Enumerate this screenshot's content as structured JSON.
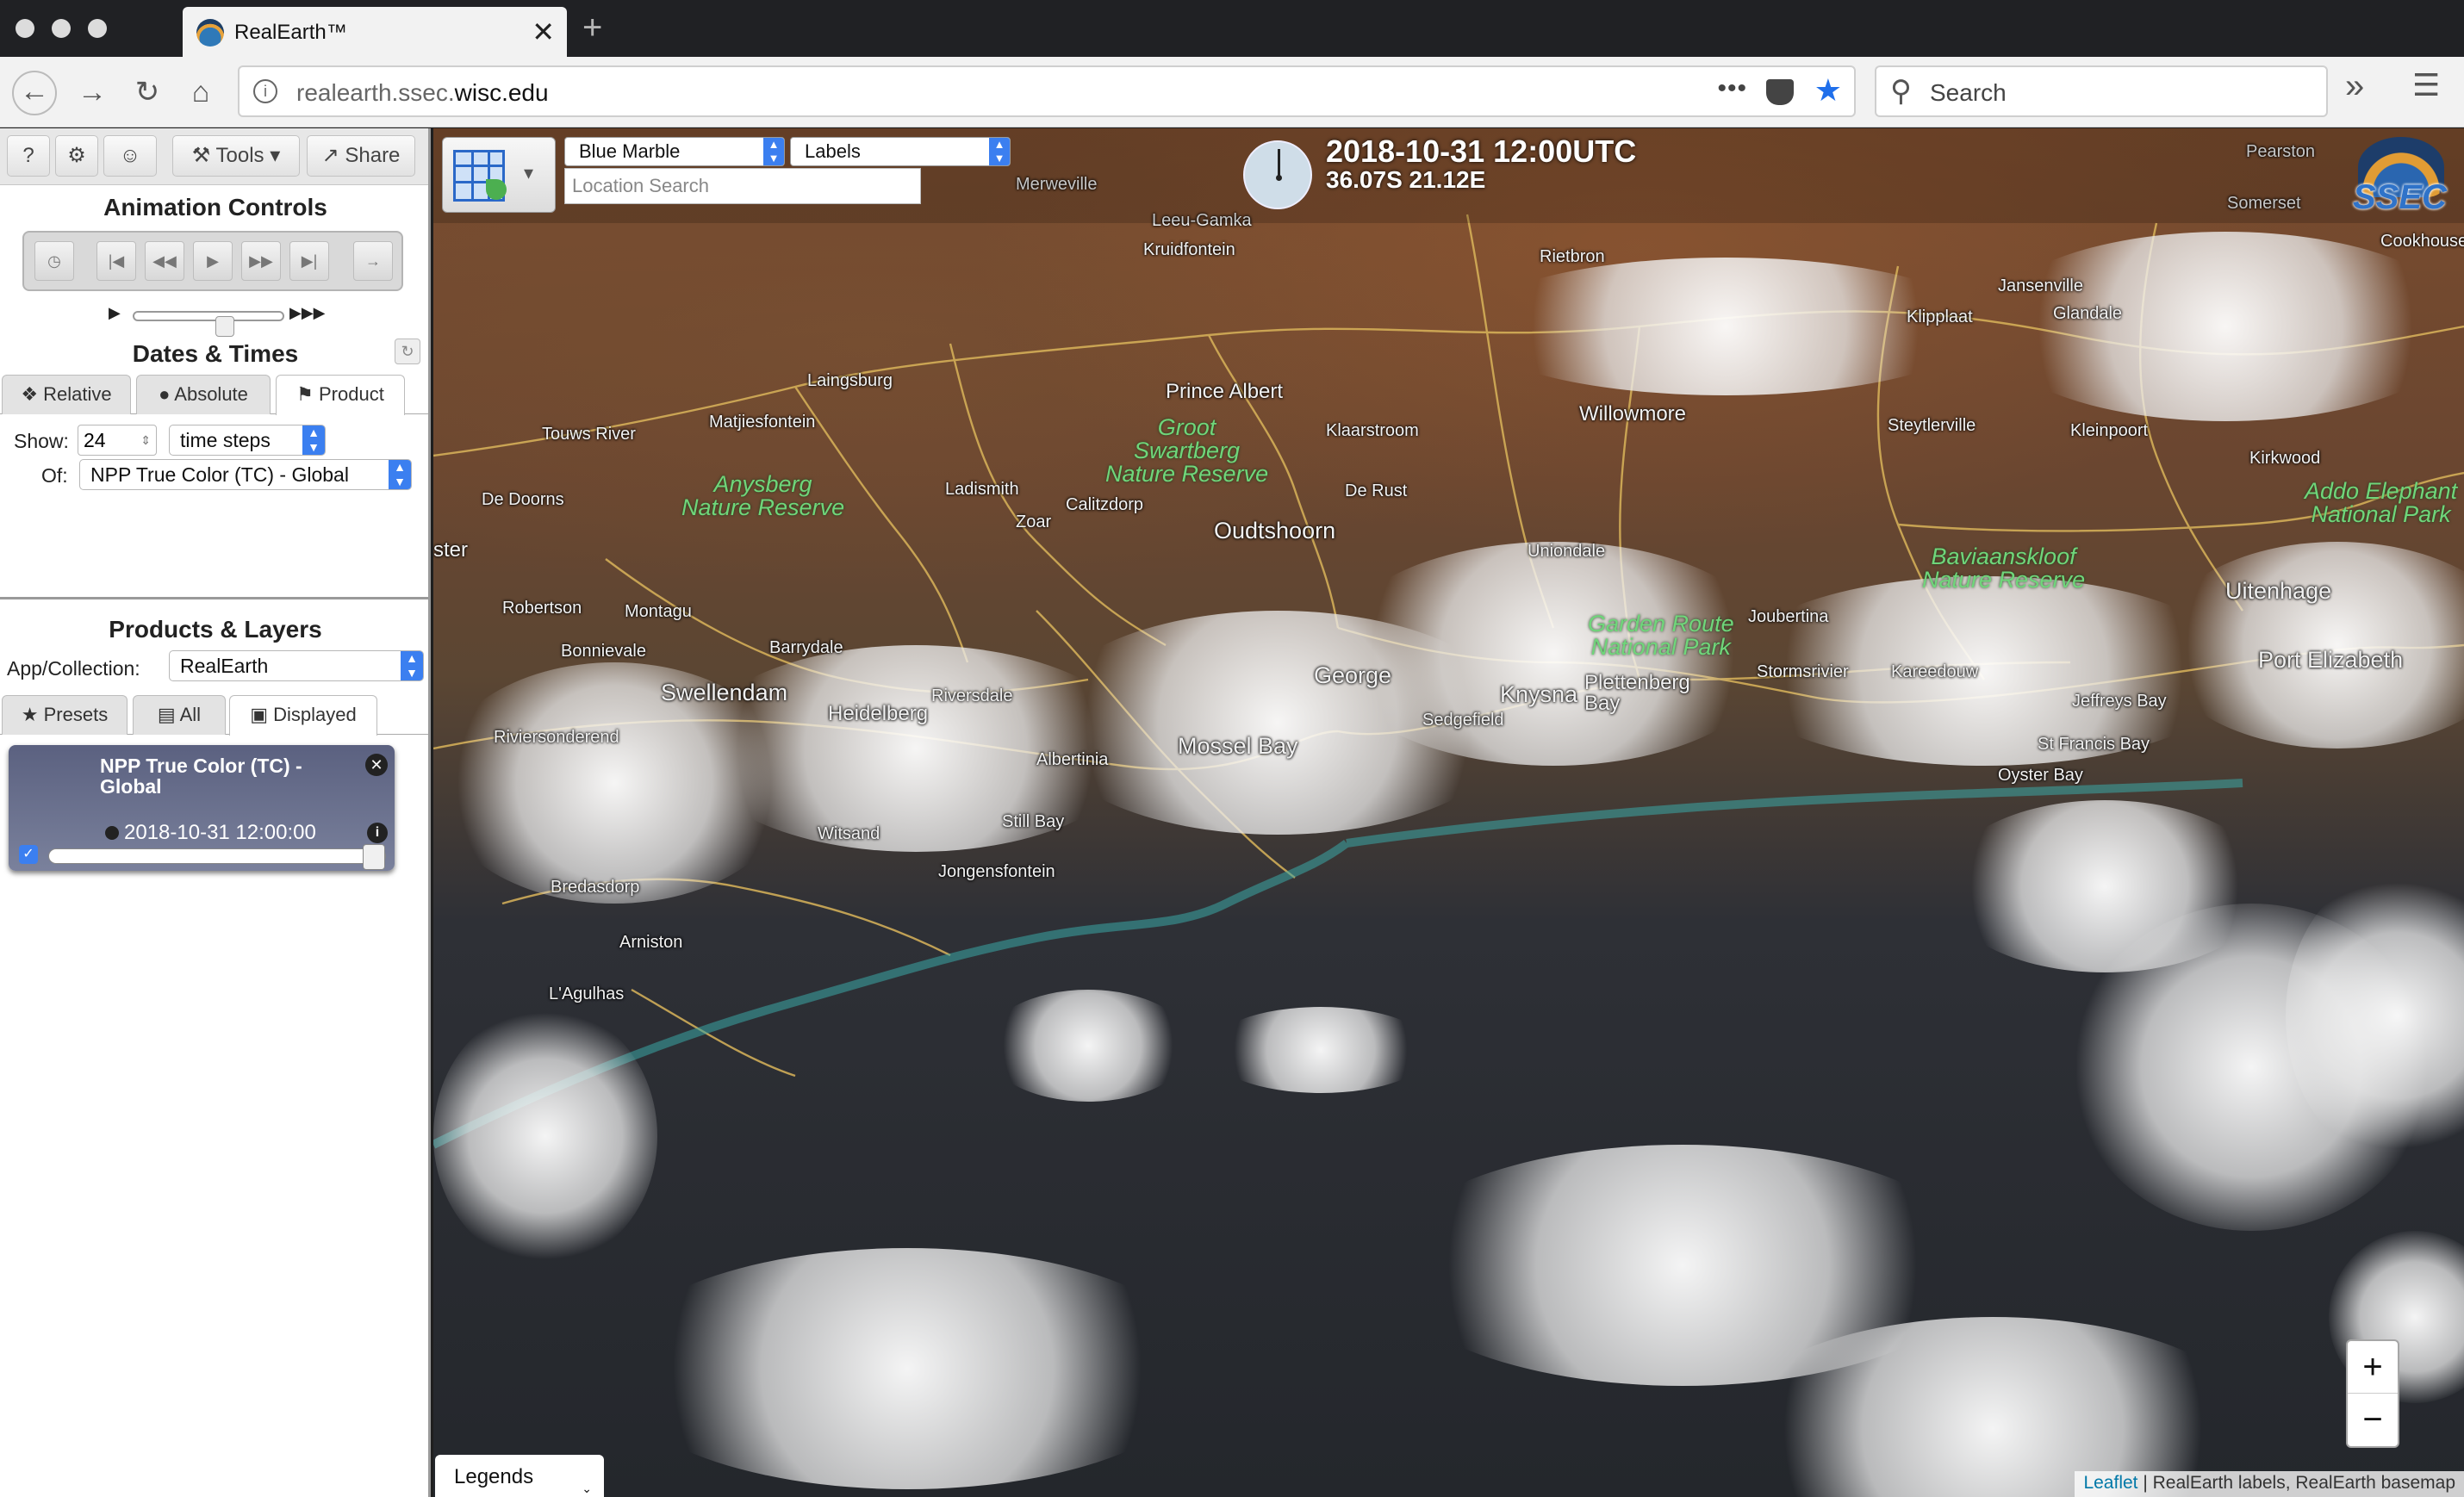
{
  "browser": {
    "tab_title": "RealEarth™",
    "tab_close": "✕",
    "new_tab": "+",
    "url_host": "realearth.ssec.",
    "url_domain": "wisc.edu",
    "search_placeholder": "Search",
    "page_actions": "•••"
  },
  "sidebar": {
    "toolbar": {
      "help": "?",
      "settings": "⚙",
      "user": "☺",
      "tools": "Tools",
      "share": "Share"
    },
    "animation_title": "Animation Controls",
    "dates_title": "Dates & Times",
    "date_tabs": [
      {
        "label": "Relative"
      },
      {
        "label": "Absolute"
      },
      {
        "label": "Product"
      }
    ],
    "active_date_tab": "Product",
    "show_label": "Show:",
    "show_value": "24",
    "steps_select": "time steps",
    "of_label": "Of:",
    "product_select": "NPP True Color (TC) - Global",
    "products_title": "Products & Layers",
    "collection_label": "App/Collection:",
    "collection_select": "RealEarth",
    "layer_tabs": [
      {
        "label": "Presets"
      },
      {
        "label": "All"
      },
      {
        "label": "Displayed"
      }
    ],
    "active_layer_tab": "Displayed",
    "layer": {
      "name": "NPP True Color (TC) - Global",
      "time": "2018-10-31 12:00:00",
      "visible": true,
      "opacity": 1.0
    }
  },
  "map": {
    "basemap_select": "Blue Marble",
    "labels_select": "Labels",
    "location_search_placeholder": "Location Search",
    "datetime": "2018-10-31 12:00UTC",
    "coords": "36.07S 21.12E",
    "logo": "SSEC",
    "zoom_in": "+",
    "zoom_out": "−",
    "legends": "Legends",
    "attribution_link": "Leaflet",
    "attribution_text": " | RealEarth labels, RealEarth basemap",
    "places": [
      {
        "name": "Merweville"
      },
      {
        "name": "Leeu-Gamka"
      },
      {
        "name": "Kruidfontein"
      },
      {
        "name": "Rietbron"
      },
      {
        "name": "Pearston"
      },
      {
        "name": "Somerset"
      },
      {
        "name": "Cookhouse"
      },
      {
        "name": "Jansenville"
      },
      {
        "name": "Klipplaat"
      },
      {
        "name": "Glandale"
      },
      {
        "name": "Laingsburg"
      },
      {
        "name": "Prince Albert"
      },
      {
        "name": "Matjiesfontein"
      },
      {
        "name": "Touws River"
      },
      {
        "name": "Klaarstroom"
      },
      {
        "name": "Willowmore"
      },
      {
        "name": "Steytlerville"
      },
      {
        "name": "Kleinpoort"
      },
      {
        "name": "Kirkwood"
      },
      {
        "name": "De Doorns"
      },
      {
        "name": "Ladismith"
      },
      {
        "name": "Calitzdorp"
      },
      {
        "name": "De Rust"
      },
      {
        "name": "Zoar"
      },
      {
        "name": "Oudtshoorn"
      },
      {
        "name": "Uniondale"
      },
      {
        "name": "ster"
      },
      {
        "name": "Robertson"
      },
      {
        "name": "Montagu"
      },
      {
        "name": "Bonnievale"
      },
      {
        "name": "Barrydale"
      },
      {
        "name": "Joubertina"
      },
      {
        "name": "Uitenhage"
      },
      {
        "name": "Port Elizabeth"
      },
      {
        "name": "George"
      },
      {
        "name": "Knysna"
      },
      {
        "name": "Plettenberg Bay"
      },
      {
        "name": "Stormsrivier"
      },
      {
        "name": "Kareedouw"
      },
      {
        "name": "Jeffreys Bay"
      },
      {
        "name": "Swellendam"
      },
      {
        "name": "Riversdale"
      },
      {
        "name": "Heidelberg"
      },
      {
        "name": "Sedgefield"
      },
      {
        "name": "Riviersonderend"
      },
      {
        "name": "Mossel Bay"
      },
      {
        "name": "Albertinia"
      },
      {
        "name": "St Francis Bay"
      },
      {
        "name": "Oyster Bay"
      },
      {
        "name": "Still Bay"
      },
      {
        "name": "Witsand"
      },
      {
        "name": "Jongensfontein"
      },
      {
        "name": "Bredasdorp"
      },
      {
        "name": "Arniston"
      },
      {
        "name": "L'Agulhas"
      }
    ],
    "reserves": [
      {
        "name": "Groot\nSwartberg\nNature Reserve"
      },
      {
        "name": "Anysberg\nNature Reserve"
      },
      {
        "name": "Garden Route\nNational Park"
      },
      {
        "name": "Baviaanskloof\nNature Reserve"
      },
      {
        "name": "Addo Elephant\nNational Park"
      }
    ]
  }
}
